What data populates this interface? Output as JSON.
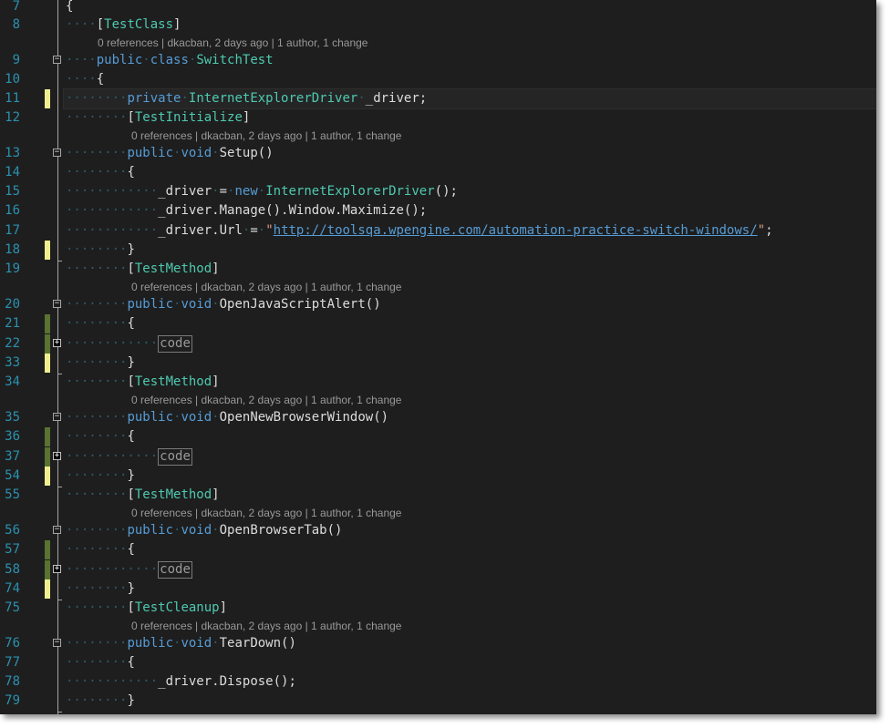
{
  "editor": {
    "codelens": {
      "references": "0 references",
      "author_info": "dkacban, 2 days ago",
      "changes": "1 author, 1 change",
      "separator": " | "
    },
    "collapsed_placeholder": "code",
    "lines": [
      {
        "num": "7",
        "text": "{"
      },
      {
        "num": "8",
        "text": "[TestClass]"
      },
      {
        "num": "9",
        "text": "public class SwitchTest"
      },
      {
        "num": "10",
        "text": "{"
      },
      {
        "num": "11",
        "text": "private InternetExplorerDriver _driver;"
      },
      {
        "num": "12",
        "text": "[TestInitialize]"
      },
      {
        "num": "13",
        "text": "public void Setup()"
      },
      {
        "num": "14",
        "text": "{"
      },
      {
        "num": "15",
        "text": "_driver = new InternetExplorerDriver();"
      },
      {
        "num": "16",
        "text": "_driver.Manage().Window.Maximize();"
      },
      {
        "num": "17",
        "text": "_driver.Url = \"http://toolsqa.wpengine.com/automation-practice-switch-windows/\";"
      },
      {
        "num": "18",
        "text": "}"
      },
      {
        "num": "19",
        "text": "[TestMethod]"
      },
      {
        "num": "20",
        "text": "public void OpenJavaScriptAlert()"
      },
      {
        "num": "21",
        "text": "{"
      },
      {
        "num": "22",
        "text": "code"
      },
      {
        "num": "33",
        "text": "}"
      },
      {
        "num": "34",
        "text": "[TestMethod]"
      },
      {
        "num": "35",
        "text": "public void OpenNewBrowserWindow()"
      },
      {
        "num": "36",
        "text": "{"
      },
      {
        "num": "37",
        "text": "code"
      },
      {
        "num": "54",
        "text": "}"
      },
      {
        "num": "55",
        "text": "[TestMethod]"
      },
      {
        "num": "56",
        "text": "public void OpenBrowserTab()"
      },
      {
        "num": "57",
        "text": "{"
      },
      {
        "num": "58",
        "text": "code"
      },
      {
        "num": "74",
        "text": "}"
      },
      {
        "num": "75",
        "text": "[TestCleanup]"
      },
      {
        "num": "76",
        "text": "public void TearDown()"
      },
      {
        "num": "77",
        "text": "{"
      },
      {
        "num": "78",
        "text": "_driver.Dispose();"
      },
      {
        "num": "79",
        "text": "}"
      }
    ],
    "tokens": {
      "kw_public": "public",
      "kw_class": "class",
      "kw_private": "private",
      "kw_void": "void",
      "kw_new": "new",
      "type_switchtest": "SwitchTest",
      "type_iedriver": "InternetExplorerDriver",
      "attr_testclass": "TestClass",
      "attr_testinit": "TestInitialize",
      "attr_testmethod": "TestMethod",
      "attr_testcleanup": "TestCleanup",
      "field_driver": "_driver",
      "method_setup": "Setup",
      "method_alert": "OpenJavaScriptAlert",
      "method_newwindow": "OpenNewBrowserWindow",
      "method_tab": "OpenBrowserTab",
      "method_teardown": "TearDown",
      "manage_chain": ".Manage().Window.Maximize();",
      "url_prop": ".Url",
      "url": "http://toolsqa.wpengine.com/automation-practice-switch-windows/",
      "dispose_call": ".Dispose();"
    }
  },
  "colors": {
    "background": "#1e1e1e",
    "line_number": "#2b91af",
    "keyword": "#569cd6",
    "type": "#4ec9b0",
    "string": "#d69d85",
    "codelens": "#999999",
    "change_saved": "#5a7332",
    "change_unsaved": "#efef91"
  }
}
